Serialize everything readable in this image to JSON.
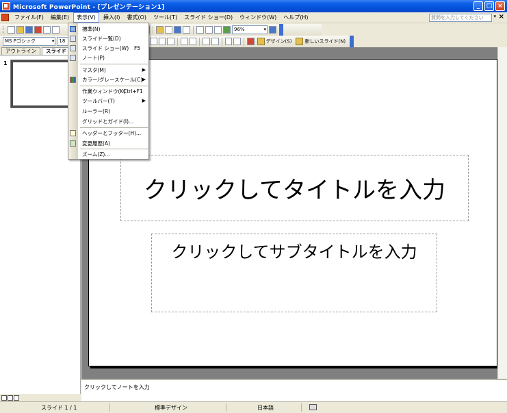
{
  "window": {
    "title": "Microsoft PowerPoint - [プレゼンテーション1]",
    "buttons": [
      "_",
      "□",
      "×"
    ]
  },
  "menubar": {
    "items": [
      "ファイル(F)",
      "編集(E)",
      "表示(V)",
      "挿入(I)",
      "書式(O)",
      "ツール(T)",
      "スライド ショー(D)",
      "ウィンドウ(W)",
      "ヘルプ(H)"
    ],
    "active_index": 2,
    "help_placeholder": "質問を入力してください"
  },
  "toolbar_standard": {
    "zoom": "96%"
  },
  "toolbar_format": {
    "font_name": "MS Pゴシック",
    "font_size": "18",
    "design_label": "デザイン(S)",
    "new_slide_label": "新しいスライド(N)"
  },
  "left_panel": {
    "tabs": [
      "アウトライン",
      "スライド"
    ],
    "selected_tab": 1,
    "slide_number": "1"
  },
  "view_menu": {
    "items": [
      {
        "label": "標準(N)",
        "icon": "normal-view-icon"
      },
      {
        "label": "スライド一覧(D)",
        "icon": "slide-sorter-icon"
      },
      {
        "label": "スライド ショー(W)",
        "shortcut": "F5",
        "icon": "slideshow-icon"
      },
      {
        "label": "ノート(P)",
        "icon": "notes-page-icon"
      },
      {
        "label": "マスタ(M)",
        "submenu": true
      },
      {
        "label": "カラー/グレースケール(C)",
        "submenu": true,
        "icon": "color-grayscale-icon"
      },
      {
        "label": "作業ウィンドウ(K)",
        "shortcut": "Ctrl+F1"
      },
      {
        "label": "ツールバー(T)",
        "submenu": true
      },
      {
        "label": "ルーラー(R)"
      },
      {
        "label": "グリッドとガイド(I)..."
      },
      {
        "label": "ヘッダーとフッター(H)...",
        "icon": "header-footer-icon"
      },
      {
        "label": "変更履歴(A)",
        "icon": "revisions-icon"
      },
      {
        "label": "ズーム(Z)..."
      }
    ]
  },
  "slide": {
    "title_placeholder": "クリックしてタイトルを入力",
    "subtitle_placeholder": "クリックしてサブタイトルを入力"
  },
  "notes": {
    "placeholder": "クリックしてノートを入力"
  },
  "statusbar": {
    "slide_info": "スライド 1 / 1",
    "design": "標準デザイン",
    "language": "日本語"
  }
}
